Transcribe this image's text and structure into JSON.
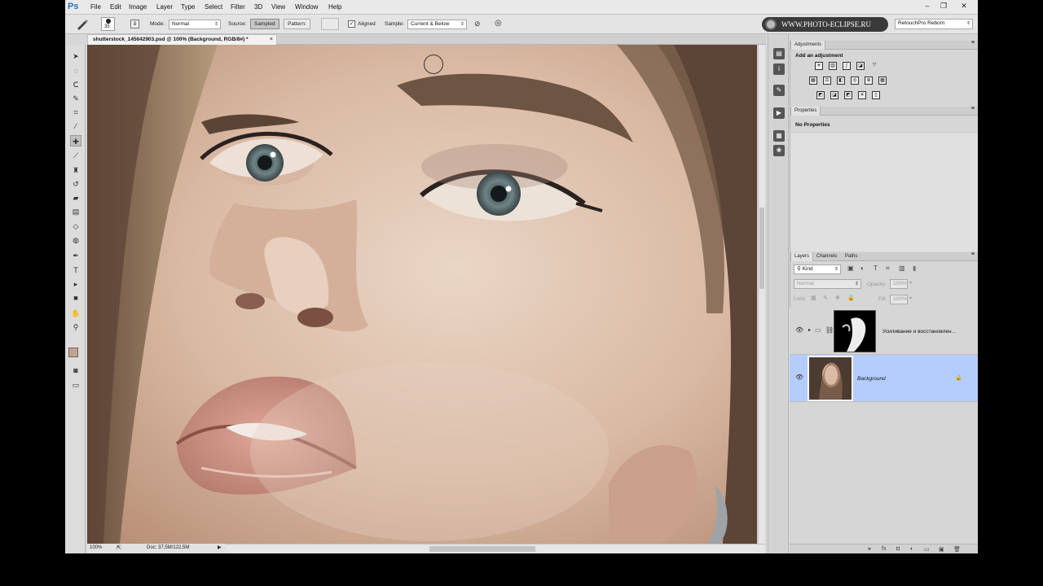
{
  "app": {
    "logo": "Ps"
  },
  "menu": [
    "File",
    "Edit",
    "Image",
    "Layer",
    "Type",
    "Select",
    "Filter",
    "3D",
    "View",
    "Window",
    "Help"
  ],
  "window_controls": {
    "minimize": "–",
    "restore": "❐",
    "close": "✕"
  },
  "options": {
    "brush_size": "35",
    "mode_label": "Mode:",
    "mode_value": "Normal",
    "source_label": "Source:",
    "source_sampled": "Sampled",
    "source_pattern": "Pattern:",
    "aligned_label": "Aligned",
    "sample_label": "Sample:",
    "sample_value": "Current & Below",
    "brand": "WWW.PHOTO-ECLIPSE.RU",
    "workspace": "RetouchPro Reborn"
  },
  "document": {
    "tab_title": "shutterstock_145642903.psd @ 100% (Background, RGB/8#) *",
    "zoom": "100%",
    "doc_size": "Doc: 37,5M/122,5M"
  },
  "adjustments": {
    "tab": "Adjustments",
    "heading": "Add an adjustment"
  },
  "properties": {
    "tab": "Properties",
    "message": "No Properties"
  },
  "layers_panel": {
    "tabs": [
      "Layers",
      "Channels",
      "Paths"
    ],
    "filter_kind": "Kind",
    "blend_mode": "Normal",
    "opacity_label": "Opacity:",
    "opacity_value": "100%",
    "lock_label": "Lock:",
    "fill_label": "Fill:",
    "fill_value": "100%",
    "layers": [
      {
        "name": "Усиливание и восстановлен...",
        "type": "group",
        "selected": false
      },
      {
        "name": "Background",
        "type": "pixel",
        "selected": true,
        "locked": true
      }
    ]
  },
  "colors": {
    "selection": "#b5cdfd",
    "foreground": "#c6a28a",
    "background_swatch": "#000000"
  }
}
